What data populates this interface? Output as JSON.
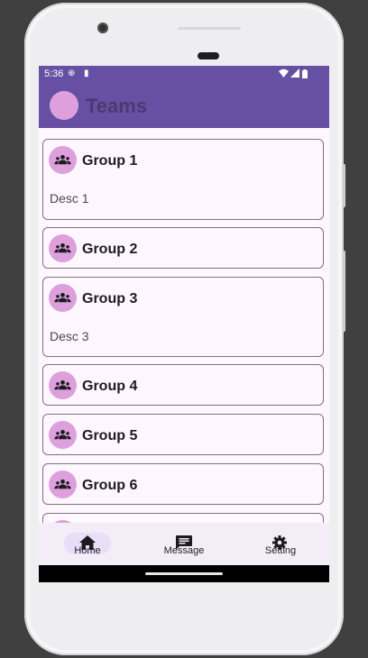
{
  "status_bar": {
    "time": "5:36",
    "icons": [
      "globe-icon",
      "sim-card-icon",
      "wifi-icon",
      "signal-icon"
    ]
  },
  "app_bar": {
    "title": "Teams",
    "avatar_color": "#dda0dd",
    "background": "#6750a4"
  },
  "groups": [
    {
      "title": "Group 1",
      "description": "Desc 1",
      "icon": "groups-icon"
    },
    {
      "title": "Group 2",
      "description": "",
      "icon": "groups-icon"
    },
    {
      "title": "Group 3",
      "description": "Desc 3",
      "icon": "groups-icon"
    },
    {
      "title": "Group 4",
      "description": "",
      "icon": "groups-icon"
    },
    {
      "title": "Group 5",
      "description": "",
      "icon": "groups-icon"
    },
    {
      "title": "Group 6",
      "description": "",
      "icon": "groups-icon"
    }
  ],
  "bottom_nav": {
    "items": [
      {
        "label": "Home",
        "icon": "home-icon",
        "selected": true
      },
      {
        "label": "Message",
        "icon": "message-icon",
        "selected": false
      },
      {
        "label": "Setting",
        "icon": "settings-icon",
        "selected": false
      }
    ]
  },
  "colors": {
    "primary": "#6750a4",
    "accent": "#dda0dd",
    "surface": "#fef7ff",
    "nav_background": "#f3edf7",
    "nav_indicator": "#e8def8"
  }
}
